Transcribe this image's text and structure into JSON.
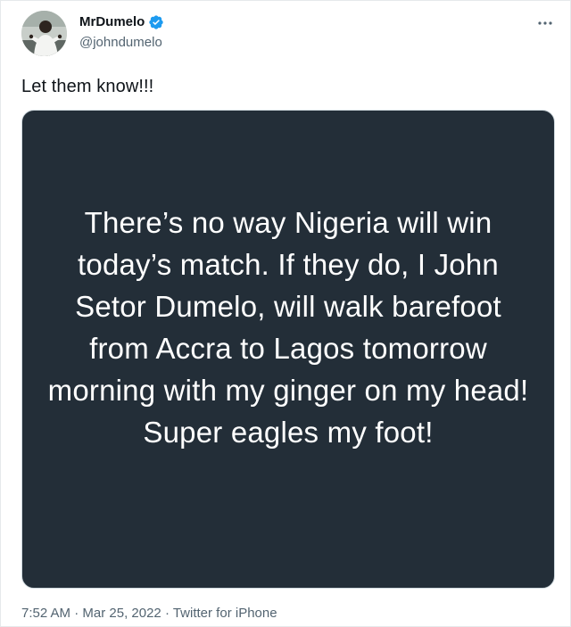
{
  "author": {
    "display_name": "MrDumelo",
    "handle": "@johndumelo",
    "verified": true,
    "avatar_icon": "profile-photo"
  },
  "tweet": {
    "text": "Let them know!!!",
    "image_text": "There’s no way Nigeria will win today’s match. If they do, I John Setor Dumelo, will walk barefoot from Accra to Lagos tomorrow morning with my ginger on my head! Super eagles my foot!"
  },
  "meta": {
    "time": "7:52 AM",
    "separator": " · ",
    "date": "Mar 25, 2022",
    "source": "Twitter for iPhone"
  },
  "icons": {
    "verified": "verified-badge-icon",
    "more": "more-options-icon"
  },
  "colors": {
    "verified_blue": "#1d9bf0",
    "card_background": "#232e38",
    "secondary_text": "#536471"
  }
}
